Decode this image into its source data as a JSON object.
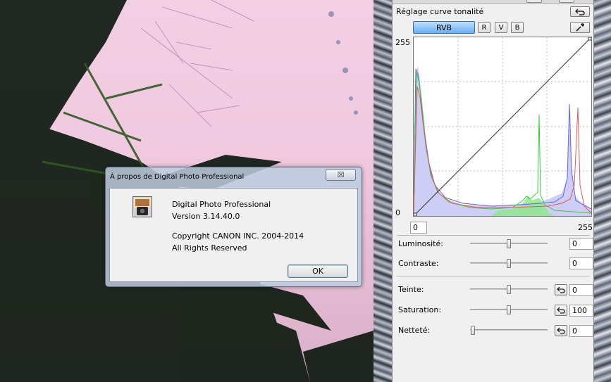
{
  "panel": {
    "title": "Réglage curve tonalité",
    "channels": {
      "all": "RVB",
      "r": "R",
      "g": "V",
      "b": "B"
    },
    "axis": {
      "y_max": "255",
      "y_min": "0",
      "x_min": "0",
      "x_max": "255"
    },
    "luminosity": {
      "label": "Luminosité:",
      "value": "0"
    },
    "contrast": {
      "label": "Contraste:",
      "value": "0"
    },
    "tint": {
      "label": "Teinte:",
      "value": "0"
    },
    "saturation": {
      "label": "Saturation:",
      "value": "100"
    },
    "sharpness": {
      "label": "Netteté:",
      "value": "0"
    },
    "icons": [
      "reset-arrow-icon",
      "eyedropper-icon"
    ]
  },
  "dialog": {
    "title": "À propos de Digital Photo Professional",
    "close": "☒",
    "app_name": "Digital Photo Professional",
    "version": "Version 3.14.40.0",
    "copyright": "Copyright CANON INC. 2004-2014",
    "rights": "All Rights Reserved",
    "ok": "OK"
  },
  "colors": {
    "accent": "#6aaef0",
    "hist_red": "#e05a5a",
    "hist_green": "#3cc83c",
    "hist_blue": "#6464e6",
    "hist_fill": "#c8c8f5"
  }
}
